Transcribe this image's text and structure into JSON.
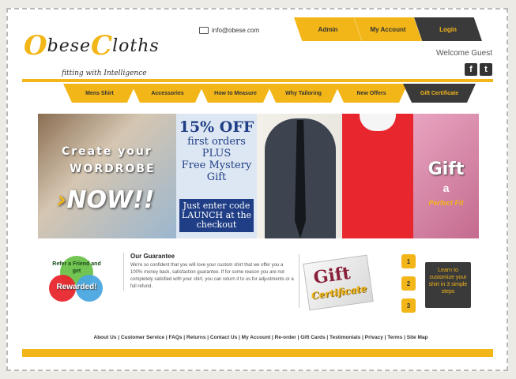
{
  "brand": {
    "logo_first": "O",
    "logo_word1": "bese",
    "logo_second": "C",
    "logo_word2": "loths",
    "tagline": "fitting with Intelligence"
  },
  "contact": {
    "email": "info@obese.com"
  },
  "top_tabs": [
    {
      "label": "Admin"
    },
    {
      "label": "My Account"
    },
    {
      "label": "Login"
    }
  ],
  "welcome": "Welcome Guest",
  "social": {
    "facebook": "f",
    "twitter": "t"
  },
  "nav": [
    {
      "label": "Mens Shirt"
    },
    {
      "label": "Accessories"
    },
    {
      "label": "How to Measure"
    },
    {
      "label": "Why Tailoring"
    },
    {
      "label": "New Offers"
    },
    {
      "label": "Gift Certificate"
    }
  ],
  "banner": {
    "create_line1": "Create your",
    "create_line2": "WORDROBE",
    "create_line3": "NOW!!",
    "offer_percent": "15% OFF",
    "offer_line2": "first orders",
    "offer_line3": "PLUS",
    "offer_line4": "Free Mystery",
    "offer_line5": "Gift",
    "code_box": "Just enter code LAUNCH at the checkout",
    "gift_word": "Gift",
    "gift_a": "a",
    "gift_fit": "Perfect Fit"
  },
  "promo": {
    "line": "Refer a Friend and get",
    "reward": "Rewarded!"
  },
  "guarantee": {
    "title": "Our Guarantee",
    "text": "We're so confident that you will love your custom shirt that we offer you a 100% money back, satisfaction guarantee. If for some reason you are not completely satisfied with your shirt, you can return it to us for adjustments or a full refund."
  },
  "gift_certificate": {
    "word1": "Gift",
    "word2": "Certificate"
  },
  "steps": [
    "1",
    "2",
    "3"
  ],
  "learn_box": "Learn to customize your shirt in 3 simple steps",
  "footer_links": "About Us | Customer Service | FAQs | Returns | Contact Us | My Account | Re-order | Gift Cards | Testimonials | Privacy | Terms | Site Map",
  "colors": {
    "accent": "#f2b619",
    "dark": "#3a3a3a",
    "promo_red": "#e8262e",
    "offer_blue": "#1f3e85"
  }
}
